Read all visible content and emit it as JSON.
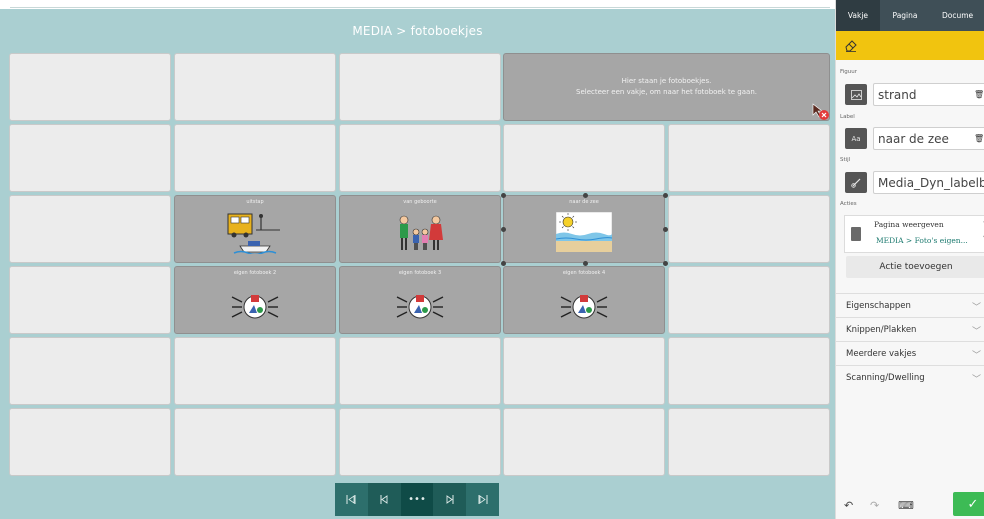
{
  "editor": {
    "title": "MEDIA > fotoboekjes",
    "note_line1": "Hier staan je fotoboekjes.",
    "note_line2": "Selecteer een vakje, om naar het fotoboek te gaan.",
    "cells": {
      "uitstap": "uitstap",
      "van_geboorte": "van geboorte",
      "naar_de_zee": "naar de zee",
      "eigen_fotoboek_2": "eigen fotoboek 2",
      "eigen_fotoboek_3": "eigen fotoboek 3",
      "eigen_fotoboek_4": "eigen fotoboek 4"
    }
  },
  "nav": {
    "first_icon": "skip-first-icon",
    "prev_icon": "skip-prev-icon",
    "more": "•••",
    "next_icon": "skip-next-icon",
    "last_icon": "skip-last-icon"
  },
  "panel": {
    "tabs": [
      "Vakje",
      "Pagina",
      "Docume"
    ],
    "figuur_label": "Figuur",
    "figuur_value": "strand",
    "label_label": "Label",
    "label_value": "naar de zee",
    "label_icon_text": "Aa",
    "stijl_label": "Stijl",
    "stijl_value": "Media_Dyn_labelbov",
    "acties_label": "Acties",
    "action_title": "Pagina weergeven",
    "action_link": "MEDIA > Foto's eigen...",
    "add_action": "Actie toevoegen",
    "accordions": [
      "Eigenschappen",
      "Knippen/Plakken",
      "Meerdere vakjes",
      "Scanning/Dwelling"
    ]
  },
  "colors": {
    "accent_teal": "#aacfd1",
    "nav_dark": "#0f4b47",
    "panel_yellow": "#f1c40f",
    "ok_green": "#3dbb55",
    "link_teal": "#1c7a6f"
  }
}
